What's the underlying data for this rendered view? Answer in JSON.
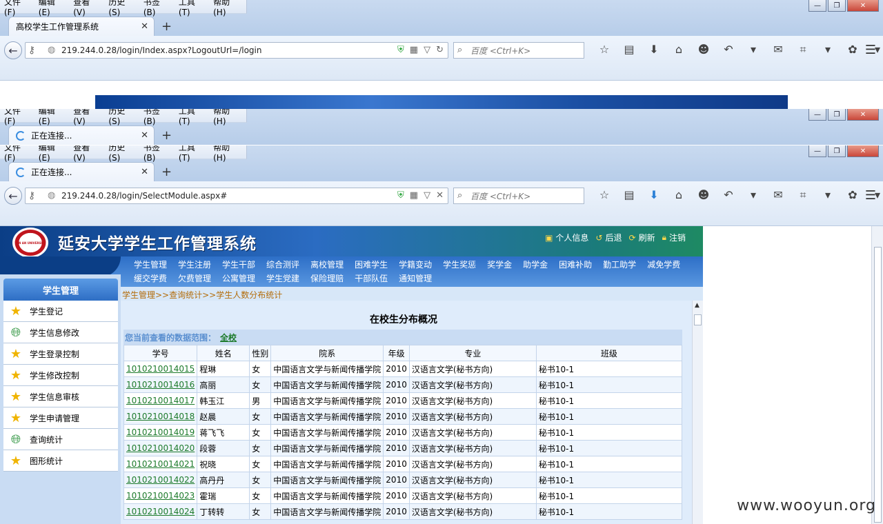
{
  "browser": {
    "menu": [
      "文件(F)",
      "编辑(E)",
      "查看(V)",
      "历史(S)",
      "书签(B)",
      "工具(T)",
      "帮助(H)"
    ],
    "window_controls": {
      "minimize": "—",
      "restore": "❐",
      "close": "✕"
    },
    "new_tab": "+",
    "search_placeholder": "百度 <Ctrl+K>",
    "windows": [
      {
        "tab_title": "高校学生工作管理系统",
        "url": "219.244.0.28/login/Index.aspx?LogoutUrl=/login"
      },
      {
        "tab_title": "正在连接..."
      },
      {
        "tab_title": "正在连接...",
        "url": "219.244.0.28/login/SelectModule.aspx#"
      }
    ]
  },
  "system": {
    "title": "延安大学学生工作管理系统",
    "logo_text": "YAN AN UNIVERSITY",
    "top_links": [
      "个人信息",
      "后退",
      "刷新",
      "注销"
    ],
    "nav_row1": [
      "学生管理",
      "学生注册",
      "学生干部",
      "综合测评",
      "离校管理",
      "困难学生",
      "学籍变动",
      "学生奖惩",
      "奖学金",
      "助学金",
      "困难补助",
      "勤工助学",
      "减免学费"
    ],
    "nav_row2": [
      "缓交学费",
      "欠费管理",
      "公寓管理",
      "学生党建",
      "保险理赔",
      "干部队伍",
      "通知管理"
    ]
  },
  "sidebar": {
    "heading": "学生管理",
    "items": [
      {
        "label": "学生登记",
        "icon": "star"
      },
      {
        "label": "学生信息修改",
        "icon": "globe"
      },
      {
        "label": "学生登录控制",
        "icon": "star"
      },
      {
        "label": "学生修改控制",
        "icon": "star"
      },
      {
        "label": "学生信息审核",
        "icon": "star"
      },
      {
        "label": "学生申请管理",
        "icon": "star"
      },
      {
        "label": "查询统计",
        "icon": "globe"
      },
      {
        "label": "图形统计",
        "icon": "star"
      }
    ]
  },
  "main": {
    "breadcrumb": "学生管理>>查询统计>>学生人数分布统计",
    "page_title": "在校生分布概况",
    "scope_label": "您当前查看的数据范围：",
    "scope_value": "全校",
    "columns": [
      "学号",
      "姓名",
      "性别",
      "院系",
      "年级",
      "专业",
      "班级"
    ],
    "rows": [
      [
        "1010210014015",
        "程琳",
        "女",
        "中国语言文学与新闻传播学院",
        "2010",
        "汉语言文学(秘书方向)",
        "秘书10-1"
      ],
      [
        "1010210014016",
        "高丽",
        "女",
        "中国语言文学与新闻传播学院",
        "2010",
        "汉语言文学(秘书方向)",
        "秘书10-1"
      ],
      [
        "1010210014017",
        "韩玉江",
        "男",
        "中国语言文学与新闻传播学院",
        "2010",
        "汉语言文学(秘书方向)",
        "秘书10-1"
      ],
      [
        "1010210014018",
        "赵晨",
        "女",
        "中国语言文学与新闻传播学院",
        "2010",
        "汉语言文学(秘书方向)",
        "秘书10-1"
      ],
      [
        "1010210014019",
        "蒋飞飞",
        "女",
        "中国语言文学与新闻传播学院",
        "2010",
        "汉语言文学(秘书方向)",
        "秘书10-1"
      ],
      [
        "1010210014020",
        "段蓉",
        "女",
        "中国语言文学与新闻传播学院",
        "2010",
        "汉语言文学(秘书方向)",
        "秘书10-1"
      ],
      [
        "1010210014021",
        "祝晓",
        "女",
        "中国语言文学与新闻传播学院",
        "2010",
        "汉语言文学(秘书方向)",
        "秘书10-1"
      ],
      [
        "1010210014022",
        "高丹丹",
        "女",
        "中国语言文学与新闻传播学院",
        "2010",
        "汉语言文学(秘书方向)",
        "秘书10-1"
      ],
      [
        "1010210014023",
        "霍瑞",
        "女",
        "中国语言文学与新闻传播学院",
        "2010",
        "汉语言文学(秘书方向)",
        "秘书10-1"
      ],
      [
        "1010210014024",
        "丁转转",
        "女",
        "中国语言文学与新闻传播学院",
        "2010",
        "汉语言文学(秘书方向)",
        "秘书10-1"
      ]
    ]
  },
  "watermark": "www.wooyun.org"
}
